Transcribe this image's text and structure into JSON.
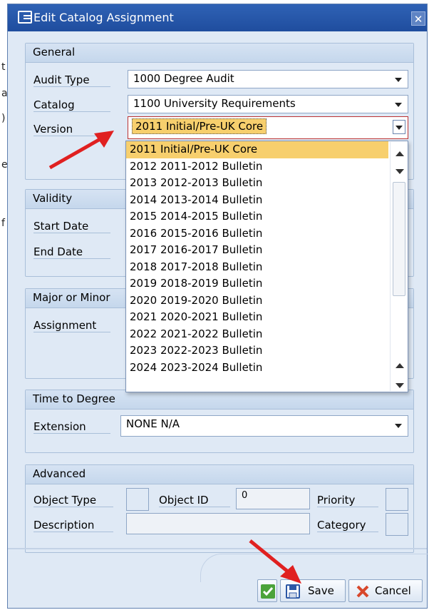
{
  "window": {
    "title": "Edit Catalog Assignment"
  },
  "general": {
    "heading": "General",
    "audit_type": {
      "label": "Audit Type",
      "value": "1000 Degree Audit"
    },
    "catalog": {
      "label": "Catalog",
      "value": "1100 University Requirements"
    },
    "version": {
      "label": "Version",
      "value": "2011 Initial/Pre-UK Core"
    }
  },
  "version_dropdown": {
    "items": [
      "2011 Initial/Pre-UK Core",
      "2012 2011-2012 Bulletin",
      "2013 2012-2013 Bulletin",
      "2014 2013-2014 Bulletin",
      "2015 2014-2015 Bulletin",
      "2016 2015-2016 Bulletin",
      "2017 2016-2017 Bulletin",
      "2018 2017-2018 Bulletin",
      "2019 2018-2019 Bulletin",
      "2020 2019-2020 Bulletin",
      "2021 2020-2021 Bulletin",
      "2022 2021-2022 Bulletin",
      "2023 2022-2023 Bulletin",
      "2024 2023-2024 Bulletin"
    ],
    "selected_index": 0
  },
  "validity": {
    "heading": "Validity",
    "start_label": "Start Date",
    "end_label": "End Date"
  },
  "major_minor": {
    "heading": "Major or Minor",
    "assignment_label": "Assignment"
  },
  "time_to_degree": {
    "heading": "Time to Degree",
    "extension": {
      "label": "Extension",
      "value": "NONE N/A"
    }
  },
  "advanced": {
    "heading": "Advanced",
    "object_type_label": "Object Type",
    "object_id_label": "Object ID",
    "object_id_value": "0",
    "priority_label": "Priority",
    "description_label": "Description",
    "category_label": "Category"
  },
  "footer": {
    "save_label": "Save",
    "cancel_label": "Cancel"
  },
  "colors": {
    "titlebar": "#2f62b5",
    "selection": "#f7cf6d",
    "annotation_arrow": "#e02020"
  }
}
